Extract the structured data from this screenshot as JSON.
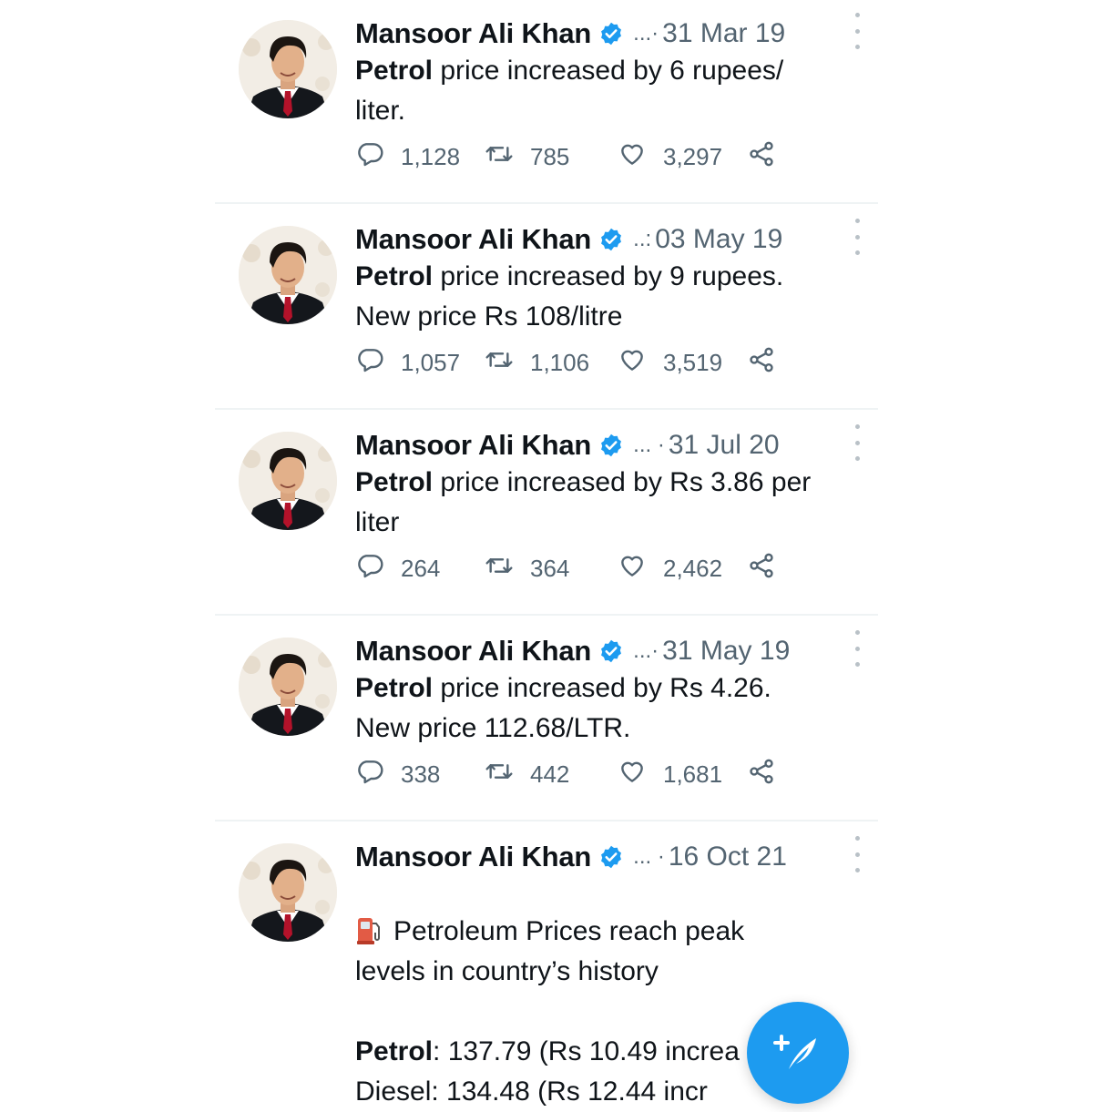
{
  "accent_color": "#1d9bf0",
  "text_color": "#0f1419",
  "muted_color": "#536471",
  "icons": {
    "verified": "verified-badge-icon",
    "more": "more-options-icon",
    "reply": "reply-icon",
    "retweet": "retweet-icon",
    "like": "like-icon",
    "share": "share-icon",
    "compose": "compose-tweet-icon",
    "fuel": "fuel-pump-emoji"
  },
  "compose_button": {
    "icon": "compose-tweet-icon",
    "plus": "+"
  },
  "tweets": [
    {
      "author": "Mansoor Ali Khan",
      "dots": "...·",
      "date": "31 Mar 19",
      "bold_lead": "Petrol",
      "text": " price increased by 6 rupees/\nliter.",
      "replies": "1,128",
      "retweets": "785",
      "likes": "3,297"
    },
    {
      "author": "Mansoor Ali Khan",
      "dots": "..:",
      "date": "03 May 19",
      "bold_lead": "Petrol",
      "text": " price increased by 9 rupees.\nNew price Rs 108/litre",
      "replies": "1,057",
      "retweets": "1,106",
      "likes": "3,519"
    },
    {
      "author": "Mansoor Ali Khan",
      "dots": "...  ·",
      "date": "31 Jul 20",
      "bold_lead": "Petrol",
      "text": " price increased by Rs 3.86 per\nliter",
      "replies": "264",
      "retweets": "364",
      "likes": "2,462"
    },
    {
      "author": "Mansoor Ali Khan",
      "dots": "...·",
      "date": "31 May 19",
      "bold_lead": "Petrol",
      "text": " price increased by Rs 4.26.\nNew price 112.68/LTR.",
      "replies": "338",
      "retweets": "442",
      "likes": "1,681"
    },
    {
      "author": "Mansoor Ali Khan",
      "dots": "... ·",
      "date": "16 Oct 21",
      "lead_text": "Petroleum Prices reach peak\nlevels in country’s history\n\n",
      "line1_label": "Petrol",
      "line1_text": ": 137.79 (Rs 10.49 increa",
      "line2_text": "Diesel: 134.48 (Rs 12.44 incr"
    }
  ]
}
